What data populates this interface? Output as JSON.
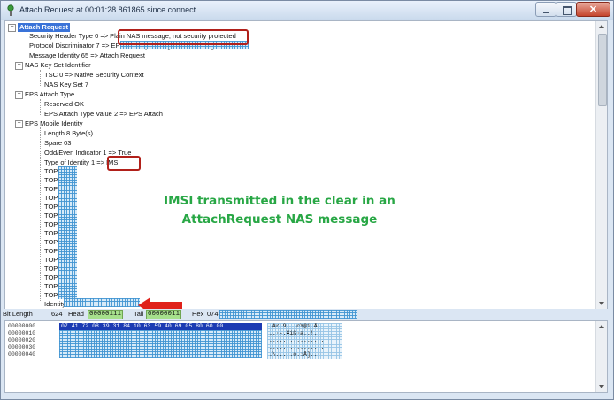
{
  "window": {
    "title": "Attach Request at 00:01:28.861865 since connect"
  },
  "tree": {
    "root": "Attach Request",
    "security_header": "Security Header Type 0 => Plain NAS message, not security protected",
    "protocol_discriminator": "Protocol Discriminator 7 => EPS mobility management messages",
    "message_identity": "Message Identity 65 => Attach Request",
    "nas_key_set": "NAS Key Set Identifier",
    "tsc": "TSC 0 => Native Security Context",
    "nas_key_set_value": "NAS Key Set 7",
    "eps_attach_type": "EPS Attach Type",
    "reserved": "Reserved OK",
    "eps_attach_value": "EPS Attach Type Value 2 => EPS Attach",
    "eps_mobile_identity": "EPS Mobile Identity",
    "length": "Length 8 Byte(s)",
    "spare": "Spare 03",
    "odd_even": "Odd/Even Indicator 1 => True",
    "type_of_identity": "Type of Identity 1 => IMSI",
    "top_items": [
      "TOP",
      "TOP",
      "TOP",
      "TOP",
      "TOP",
      "TOP",
      "TOP",
      "TOP",
      "TOP",
      "TOP",
      "TOP",
      "TOP",
      "TOP",
      "TOP",
      "TOP"
    ],
    "identity": "Identity"
  },
  "callout": {
    "line1": "IMSI transmitted  in the clear in an",
    "line2": "AttachRequest  NAS message"
  },
  "status": {
    "bit_length_label": "Bit Length",
    "bit_length_value": "624",
    "head_label": "Head",
    "head_value": "00000111",
    "tail_label": "Tail",
    "tail_value": "00000011",
    "hex_label": "Hex",
    "hex_value": "074"
  },
  "hex": {
    "offsets": [
      "00000000",
      "00000010",
      "00000020",
      "00000030",
      "00000040"
    ],
    "selected_row": "07 41 72 08 39 31 84 10 63 59 40 69 05 80 60 00",
    "ascii": [
      ".Ar.9...cY@i.Ä`.",
      "..·-.¥iß·a..!..",
      "................",
      "................",
      ".\\.....o.:Å]..."
    ]
  },
  "colors": {
    "accent_blue": "#3a73d8",
    "highlight_red": "#b1201a",
    "callout_green": "#28a745",
    "bit_green": "#a6e08c"
  }
}
